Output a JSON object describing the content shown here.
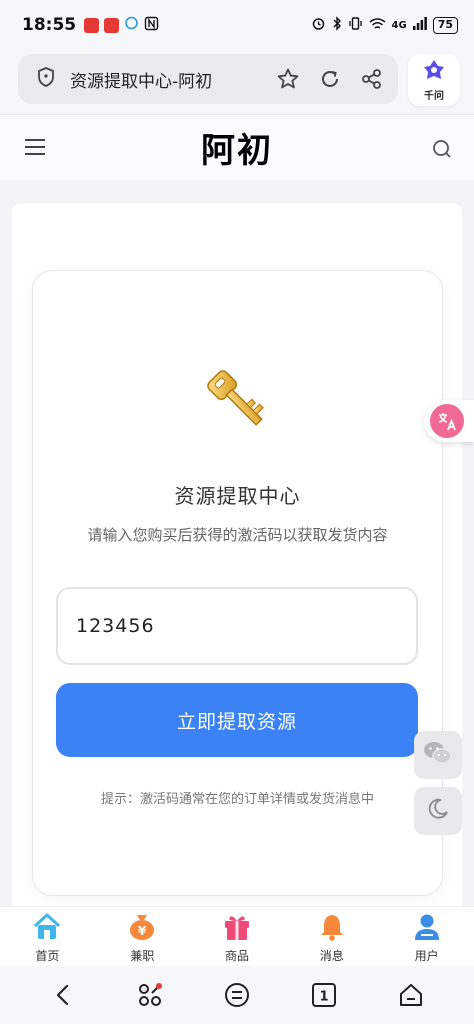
{
  "status_bar": {
    "time": "18:55",
    "network": "4G",
    "battery": "75"
  },
  "browser": {
    "page_title": "资源提取中心-阿初",
    "assistant_label": "千问"
  },
  "site_header": {
    "site_name": "阿初"
  },
  "main": {
    "heading": "资源提取中心",
    "subtitle": "请输入您购买后获得的激活码以获取发货内容",
    "code_input": {
      "value": "123456",
      "placeholder": ""
    },
    "submit_label": "立即提取资源",
    "hint": "提示：激活码通常在您的订单详情或发货消息中"
  },
  "bottom_nav": {
    "items": [
      {
        "label": "首页",
        "icon": "home-icon",
        "color": "#3fb6ea"
      },
      {
        "label": "兼职",
        "icon": "money-bag-icon",
        "color": "#f5883a"
      },
      {
        "label": "商品",
        "icon": "gift-icon",
        "color": "#ef4a7a"
      },
      {
        "label": "消息",
        "icon": "bell-icon",
        "color": "#f5883a"
      },
      {
        "label": "用户",
        "icon": "user-icon",
        "color": "#3a8ee6"
      }
    ]
  },
  "colors": {
    "primary": "#3b82f6",
    "translate": "#f06a93"
  }
}
